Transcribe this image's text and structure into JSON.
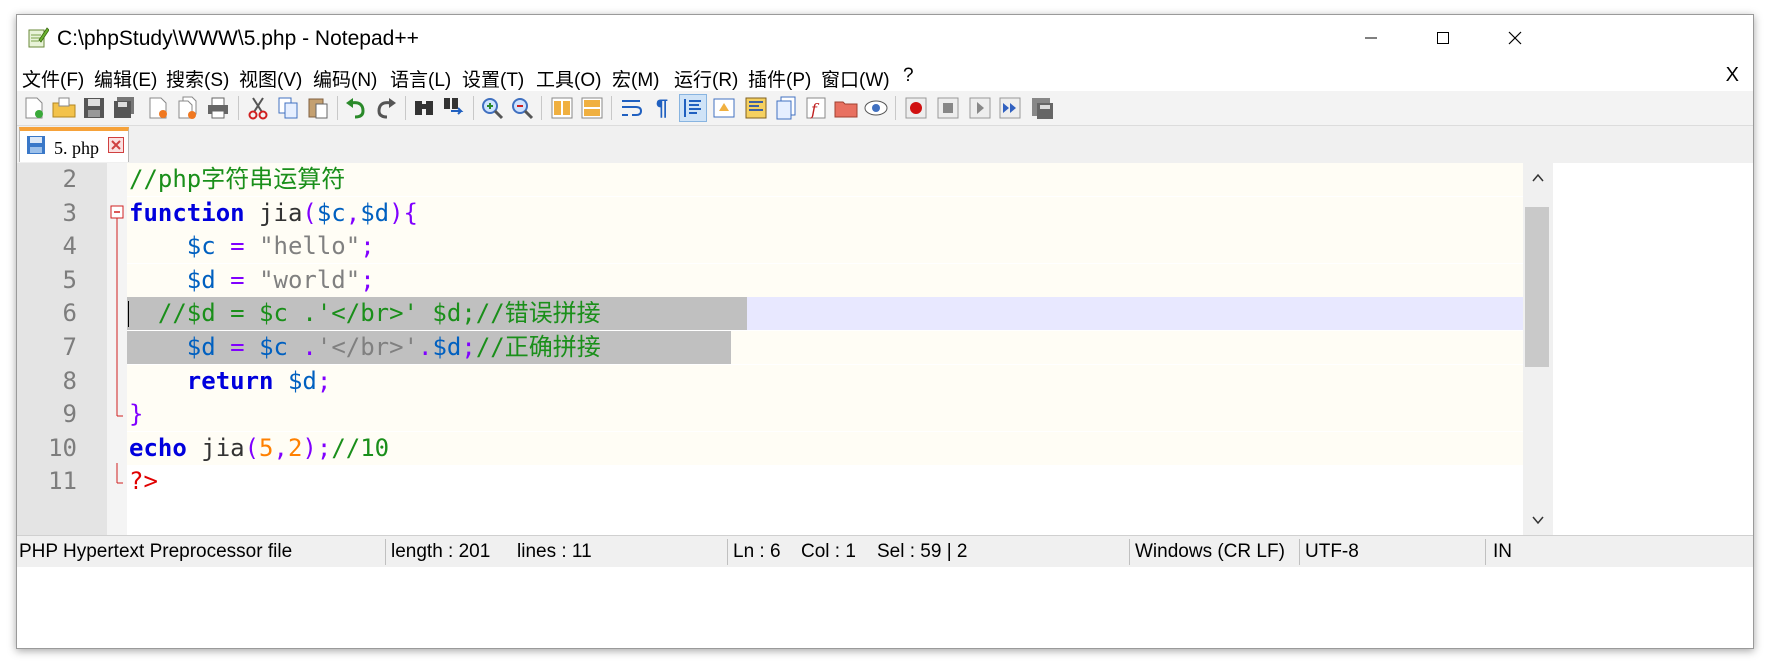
{
  "window": {
    "title": "C:\\phpStudy\\WWW\\5.php - Notepad++",
    "controls": {
      "minimize": "─",
      "maximize": "☐",
      "close": "✕"
    }
  },
  "menu": {
    "items": [
      "文件(F)",
      "编辑(E)",
      "搜索(S)",
      "视图(V)",
      "编码(N)",
      "语言(L)",
      "设置(T)",
      "工具(O)",
      "宏(M)",
      "运行(R)",
      "插件(P)",
      "窗口(W)",
      "?"
    ],
    "close_label": "X"
  },
  "tab": {
    "label": "5. php"
  },
  "editor": {
    "lines": [
      {
        "num": "2",
        "tokens": [
          {
            "t": "//php字符串运算符",
            "c": "#1a8f1a"
          }
        ]
      },
      {
        "num": "3",
        "tokens": [
          {
            "t": "function",
            "c": "#0000dd",
            "b": true
          },
          {
            "t": " jia",
            "c": "#333333"
          },
          {
            "t": "(",
            "c": "#8000ff"
          },
          {
            "t": "$c",
            "c": "#0060c0"
          },
          {
            "t": ",",
            "c": "#8000ff"
          },
          {
            "t": "$d",
            "c": "#0060c0"
          },
          {
            "t": "){",
            "c": "#8000ff"
          }
        ]
      },
      {
        "num": "4",
        "tokens": [
          {
            "t": "    ",
            "c": "#000"
          },
          {
            "t": "$c",
            "c": "#0060c0"
          },
          {
            "t": " = ",
            "c": "#8000ff"
          },
          {
            "t": "\"hello\"",
            "c": "#808080"
          },
          {
            "t": ";",
            "c": "#8000ff"
          }
        ]
      },
      {
        "num": "5",
        "tokens": [
          {
            "t": "    ",
            "c": "#000"
          },
          {
            "t": "$d",
            "c": "#0060c0"
          },
          {
            "t": " = ",
            "c": "#8000ff"
          },
          {
            "t": "\"world\"",
            "c": "#808080"
          },
          {
            "t": ";",
            "c": "#8000ff"
          }
        ]
      },
      {
        "num": "6",
        "tokens": [
          {
            "t": "  //$d = $c .'</br>' $d;//错误拼接",
            "c": "#1a8f1a"
          }
        ]
      },
      {
        "num": "7",
        "tokens": [
          {
            "t": "    ",
            "c": "#000"
          },
          {
            "t": "$d",
            "c": "#0060c0"
          },
          {
            "t": " = ",
            "c": "#8000ff"
          },
          {
            "t": "$c",
            "c": "#0060c0"
          },
          {
            "t": " .",
            "c": "#8000ff"
          },
          {
            "t": "'</br>'",
            "c": "#808080"
          },
          {
            "t": ".",
            "c": "#8000ff"
          },
          {
            "t": "$d",
            "c": "#0060c0"
          },
          {
            "t": ";",
            "c": "#8000ff"
          },
          {
            "t": "//正确拼接",
            "c": "#1a8f1a"
          }
        ]
      },
      {
        "num": "8",
        "tokens": [
          {
            "t": "    ",
            "c": "#000"
          },
          {
            "t": "return",
            "c": "#0000dd",
            "b": true
          },
          {
            "t": " ",
            "c": "#000"
          },
          {
            "t": "$d",
            "c": "#0060c0"
          },
          {
            "t": ";",
            "c": "#8000ff"
          }
        ]
      },
      {
        "num": "9",
        "tokens": [
          {
            "t": "}",
            "c": "#8000ff"
          }
        ]
      },
      {
        "num": "10",
        "tokens": [
          {
            "t": "echo",
            "c": "#0000dd",
            "b": true
          },
          {
            "t": " jia",
            "c": "#333333"
          },
          {
            "t": "(",
            "c": "#8000ff"
          },
          {
            "t": "5",
            "c": "#ff8000"
          },
          {
            "t": ",",
            "c": "#8000ff"
          },
          {
            "t": "2",
            "c": "#ff8000"
          },
          {
            "t": ");",
            "c": "#8000ff"
          },
          {
            "t": "//10",
            "c": "#1a8f1a"
          }
        ]
      },
      {
        "num": "11",
        "tokens": [
          {
            "t": "?>",
            "c": "#e00000"
          }
        ]
      }
    ]
  },
  "status": {
    "file_type": "PHP Hypertext Preprocessor file",
    "length": "length : 201",
    "lines": "lines : 11",
    "ln": "Ln : 6",
    "col": "Col : 1",
    "sel": "Sel : 59 | 2",
    "eol": "Windows (CR LF)",
    "encoding": "UTF-8",
    "mode": "IN"
  },
  "colors": {
    "current_line": "#e8e8ff",
    "line_bg": "#fffdf5",
    "selection": "#c0c0c0",
    "tab_accent": "#f6a23a"
  },
  "toolbar_icons": [
    "new-file-icon",
    "open-file-icon",
    "save-icon",
    "save-all-icon",
    "close-icon",
    "close-all-icon",
    "print-icon",
    "cut-icon",
    "copy-icon",
    "paste-icon",
    "undo-icon",
    "redo-icon",
    "find-icon",
    "replace-icon",
    "zoom-in-icon",
    "zoom-out-icon",
    "sync-vertical-icon",
    "sync-horizontal-icon",
    "word-wrap-icon",
    "show-all-chars-icon",
    "indent-guide-icon",
    "udl-icon",
    "doc-map-icon",
    "doc-list-icon",
    "function-list-icon",
    "folder-workspace-icon",
    "monitoring-icon",
    "record-macro-icon",
    "stop-macro-icon",
    "play-macro-icon",
    "run-macro-multiple-icon",
    "save-macro-icon"
  ]
}
